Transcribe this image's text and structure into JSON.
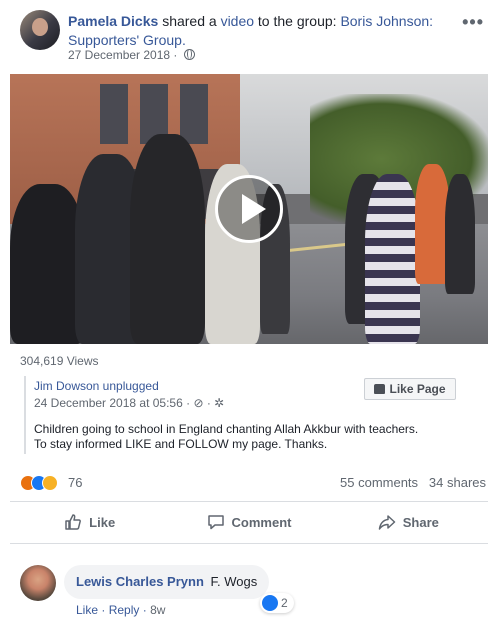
{
  "post": {
    "author": "Pamela Dicks",
    "action_prefix": "shared a",
    "object_link": "video",
    "action_suffix": "to the group:",
    "group_name": "Boris Johnson: Supporters' Group.",
    "date": "27 December 2018",
    "privacy_icon": "globe-icon",
    "more_label": "•••"
  },
  "video": {
    "views": "304,619 Views"
  },
  "shared": {
    "page_name": "Jim Dowson unplugged",
    "date": "24 December 2018 at 05:56",
    "meta_icons": "· ⊘ · ✲",
    "like_page_label": "Like Page",
    "body_line1": "Children going to school in England chanting Allah Akkbur with teachers.",
    "body_line2": "To stay informed LIKE and FOLLOW my page. Thanks."
  },
  "engagement": {
    "reaction_count": "76",
    "comments": "55 comments",
    "shares": "34 shares"
  },
  "actions": {
    "like": "Like",
    "comment": "Comment",
    "share": "Share"
  },
  "comment": {
    "author": "Lewis Charles Prynn",
    "text": "F. Wogs",
    "reaction_count": "2",
    "like": "Like",
    "reply": "Reply",
    "time": "8w"
  },
  "colors": {
    "link": "#385898",
    "like_blue": "#1877f2",
    "meta_gray": "#606770"
  }
}
